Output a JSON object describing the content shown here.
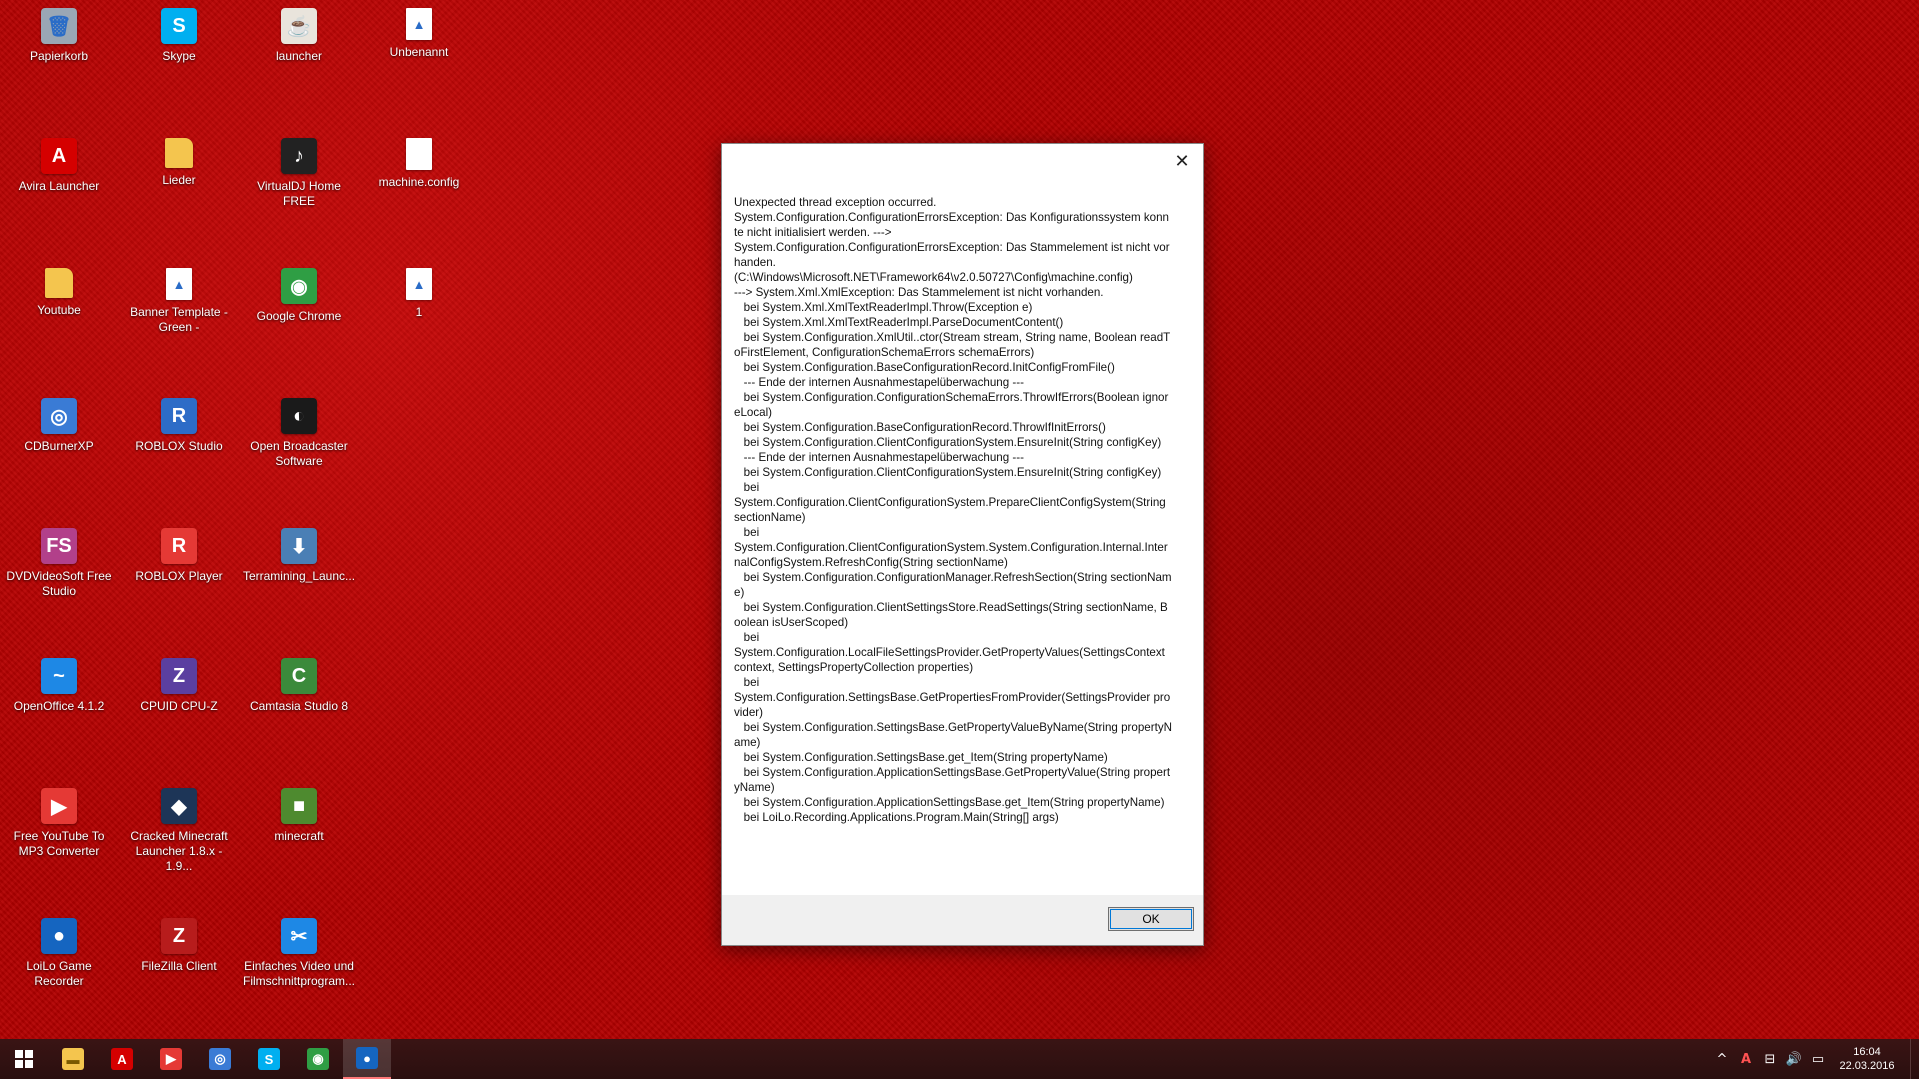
{
  "desktop": {
    "icons": [
      {
        "label": "Papierkorb",
        "icon": "recycle-bin-icon",
        "color": "#9aa7b5",
        "glyph": "🗑"
      },
      {
        "label": "Skype",
        "icon": "skype-icon",
        "color": "#00aff0",
        "glyph": "S"
      },
      {
        "label": "launcher",
        "icon": "java-icon",
        "color": "#e9e4dc",
        "glyph": "☕"
      },
      {
        "label": "Unbenannt",
        "icon": "image-file-icon",
        "color": "#ffffff",
        "glyph": "▲"
      },
      {
        "label": "Avira Launcher",
        "icon": "avira-icon",
        "color": "#d50000",
        "glyph": "A"
      },
      {
        "label": "Lieder",
        "icon": "folder-icon",
        "color": "#f4c54e",
        "glyph": ""
      },
      {
        "label": "VirtualDJ Home FREE",
        "icon": "virtualdj-icon",
        "color": "#222222",
        "glyph": "♪"
      },
      {
        "label": "machine.config",
        "icon": "file-icon",
        "color": "#ffffff",
        "glyph": ""
      },
      {
        "label": "Youtube",
        "icon": "folder-icon",
        "color": "#f4c54e",
        "glyph": ""
      },
      {
        "label": "Banner Template - Green -",
        "icon": "image-file-icon",
        "color": "#ffffff",
        "glyph": "▲"
      },
      {
        "label": "Google Chrome",
        "icon": "chrome-icon",
        "color": "#2f9e44",
        "glyph": "◉"
      },
      {
        "label": "1",
        "icon": "image-file-icon",
        "color": "#ffffff",
        "glyph": "▲"
      },
      {
        "label": "CDBurnerXP",
        "icon": "cdburnerxp-icon",
        "color": "#3a7bd5",
        "glyph": "◎"
      },
      {
        "label": "ROBLOX Studio",
        "icon": "roblox-studio-icon",
        "color": "#2d6cc7",
        "glyph": "R"
      },
      {
        "label": "Open Broadcaster Software",
        "icon": "obs-icon",
        "color": "#1a1a1a",
        "glyph": "◐"
      },
      {
        "label": "DVDVideoSoft Free Studio",
        "icon": "dvdvideosoft-icon",
        "color": "#b2408a",
        "glyph": "FS"
      },
      {
        "label": "ROBLOX Player",
        "icon": "roblox-player-icon",
        "color": "#e53935",
        "glyph": "R"
      },
      {
        "label": "Terramining_Launc...",
        "icon": "installer-icon",
        "color": "#4a7fb5",
        "glyph": "⬇"
      },
      {
        "label": "OpenOffice 4.1.2",
        "icon": "openoffice-icon",
        "color": "#1e88e5",
        "glyph": "~"
      },
      {
        "label": "CPUID CPU-Z",
        "icon": "cpuz-icon",
        "color": "#5b3fa0",
        "glyph": "Z"
      },
      {
        "label": "Camtasia Studio 8",
        "icon": "camtasia-icon",
        "color": "#3b8a3b",
        "glyph": "C"
      },
      {
        "label": "Free YouTube To MP3 Converter",
        "icon": "youtube-mp3-icon",
        "color": "#e53935",
        "glyph": "▶"
      },
      {
        "label": "Cracked Minecraft Launcher 1.8.x - 1.9...",
        "icon": "minecraft-launcher-icon",
        "color": "#1d3557",
        "glyph": "◆"
      },
      {
        "label": "minecraft",
        "icon": "minecraft-icon",
        "color": "#4e8a2f",
        "glyph": "■"
      },
      {
        "label": "LoiLo Game Recorder",
        "icon": "loilo-icon",
        "color": "#1565c0",
        "glyph": "●"
      },
      {
        "label": "FileZilla Client",
        "icon": "filezilla-icon",
        "color": "#b71c1c",
        "glyph": "Z"
      },
      {
        "label": "Einfaches Video und Filmschnittprogram...",
        "icon": "video-editor-icon",
        "color": "#1e88e5",
        "glyph": "✂"
      }
    ]
  },
  "dialog": {
    "message": "Unexpected thread exception occurred.\nSystem.Configuration.ConfigurationErrorsException: Das Konfigurationssystem konnte nicht initialisiert werden. --->\nSystem.Configuration.ConfigurationErrorsException: Das Stammelement ist nicht vorhanden.\n(C:\\Windows\\Microsoft.NET\\Framework64\\v2.0.50727\\Config\\machine.config)\n---> System.Xml.XmlException: Das Stammelement ist nicht vorhanden.\n   bei System.Xml.XmlTextReaderImpl.Throw(Exception e)\n   bei System.Xml.XmlTextReaderImpl.ParseDocumentContent()\n   bei System.Configuration.XmlUtil..ctor(Stream stream, String name, Boolean readToFirstElement, ConfigurationSchemaErrors schemaErrors)\n   bei System.Configuration.BaseConfigurationRecord.InitConfigFromFile()\n   --- Ende der internen Ausnahmestapelüberwachung ---\n   bei System.Configuration.ConfigurationSchemaErrors.ThrowIfErrors(Boolean ignoreLocal)\n   bei System.Configuration.BaseConfigurationRecord.ThrowIfInitErrors()\n   bei System.Configuration.ClientConfigurationSystem.EnsureInit(String configKey)\n   --- Ende der internen Ausnahmestapelüberwachung ---\n   bei System.Configuration.ClientConfigurationSystem.EnsureInit(String configKey)\n   bei\nSystem.Configuration.ClientConfigurationSystem.PrepareClientConfigSystem(String sectionName)\n   bei\nSystem.Configuration.ClientConfigurationSystem.System.Configuration.Internal.InternalConfigSystem.RefreshConfig(String sectionName)\n   bei System.Configuration.ConfigurationManager.RefreshSection(String sectionName)\n   bei System.Configuration.ClientSettingsStore.ReadSettings(String sectionName, Boolean isUserScoped)\n   bei\nSystem.Configuration.LocalFileSettingsProvider.GetPropertyValues(SettingsContext context, SettingsPropertyCollection properties)\n   bei\nSystem.Configuration.SettingsBase.GetPropertiesFromProvider(SettingsProvider provider)\n   bei System.Configuration.SettingsBase.GetPropertyValueByName(String propertyName)\n   bei System.Configuration.SettingsBase.get_Item(String propertyName)\n   bei System.Configuration.ApplicationSettingsBase.GetPropertyValue(String propertyName)\n   bei System.Configuration.ApplicationSettingsBase.get_Item(String propertyName)\n   bei LoiLo.Recording.Applications.Program.Main(String[] args)",
    "close_glyph": "✕",
    "ok_label": "OK"
  },
  "taskbar": {
    "start_icon": "windows-start-icon",
    "pinned": [
      {
        "name": "file-explorer-icon",
        "color": "#f4c54e",
        "glyph": "▬"
      },
      {
        "name": "avira-icon",
        "color": "#d50000",
        "glyph": "A"
      },
      {
        "name": "youtube-mp3-icon",
        "color": "#e53935",
        "glyph": "▶"
      },
      {
        "name": "cdburnerxp-icon",
        "color": "#3a7bd5",
        "glyph": "◎"
      },
      {
        "name": "skype-icon",
        "color": "#00aff0",
        "glyph": "S"
      },
      {
        "name": "chrome-icon",
        "color": "#2f9e44",
        "glyph": "◉"
      },
      {
        "name": "loilo-icon",
        "color": "#1565c0",
        "glyph": "●",
        "active": true
      }
    ],
    "tray": {
      "chevron_glyph": "^",
      "avira_glyph": "A",
      "network_glyph": "⊟",
      "volume_glyph": "🔊",
      "notification_glyph": "▭"
    },
    "clock": {
      "time": "16:04",
      "date": "22.03.2016"
    }
  }
}
